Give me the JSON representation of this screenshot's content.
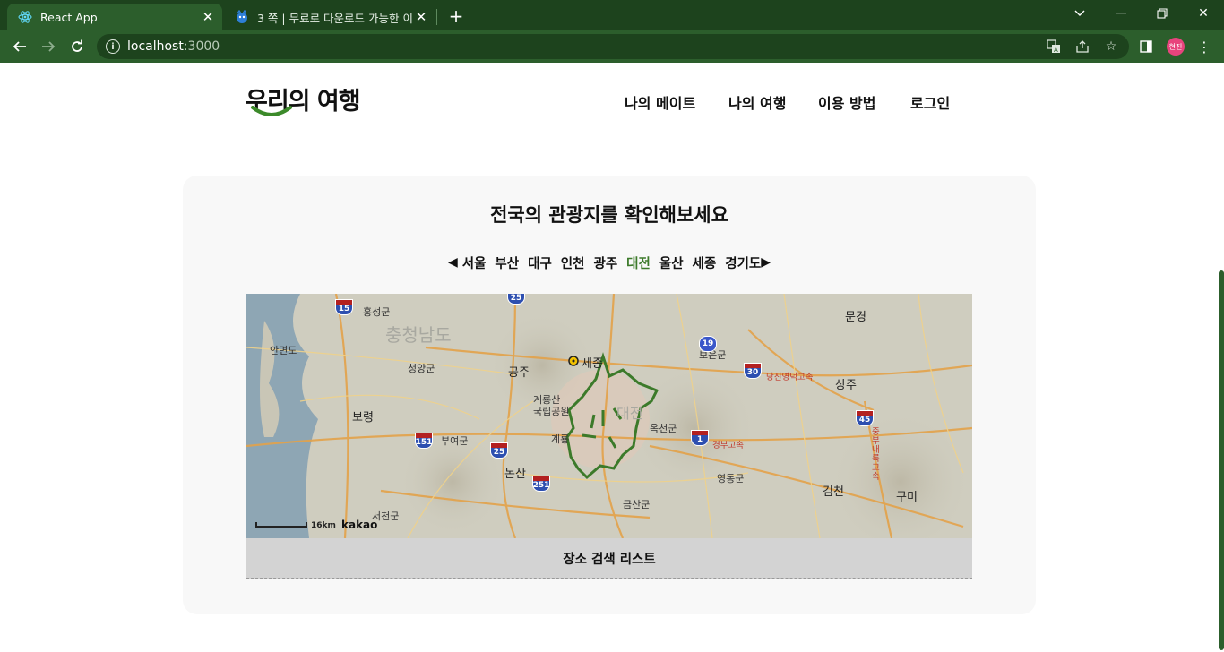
{
  "browser": {
    "tabs": [
      {
        "title": "React App",
        "active": true
      },
      {
        "title": "3 쪽 | 무료로 다운로드 가능한 이",
        "active": false
      }
    ],
    "url_host": "localhost",
    "url_port": ":3000",
    "profile_label": "현진"
  },
  "site": {
    "logo_text": "우리의 여행",
    "nav": [
      "나의 메이트",
      "나의 여행",
      "이용 방법",
      "로그인"
    ]
  },
  "main": {
    "title": "전국의 관광지를 확인해보세요",
    "regions": [
      "서울",
      "부산",
      "대구",
      "인천",
      "광주",
      "대전",
      "울산",
      "세종",
      "경기도"
    ],
    "selected_region": "대전",
    "map": {
      "provider": "kakao",
      "scale": "16km",
      "labels": [
        "충청남도",
        "홍성군",
        "안면도",
        "청양군",
        "공주",
        "세종",
        "보령",
        "부여군",
        "계룡산 국립공원",
        "계룡",
        "논산",
        "서천군",
        "보은군",
        "옥천군",
        "영동군",
        "금산군",
        "김천",
        "구미",
        "상주",
        "문경",
        "대전"
      ],
      "road_labels": [
        "당진영덕고속",
        "경부고속",
        "중부내륙고속"
      ],
      "shields": [
        "15",
        "25",
        "19",
        "30",
        "45",
        "151",
        "25",
        "251",
        "1"
      ]
    },
    "list_header": "장소 검색 리스트"
  },
  "colors": {
    "chrome_dark": "#1d431d",
    "chrome": "#2c5e2c",
    "accent": "#3c7a2a",
    "card_bg": "#f8f8f8",
    "list_bg": "#d3d3d3"
  }
}
